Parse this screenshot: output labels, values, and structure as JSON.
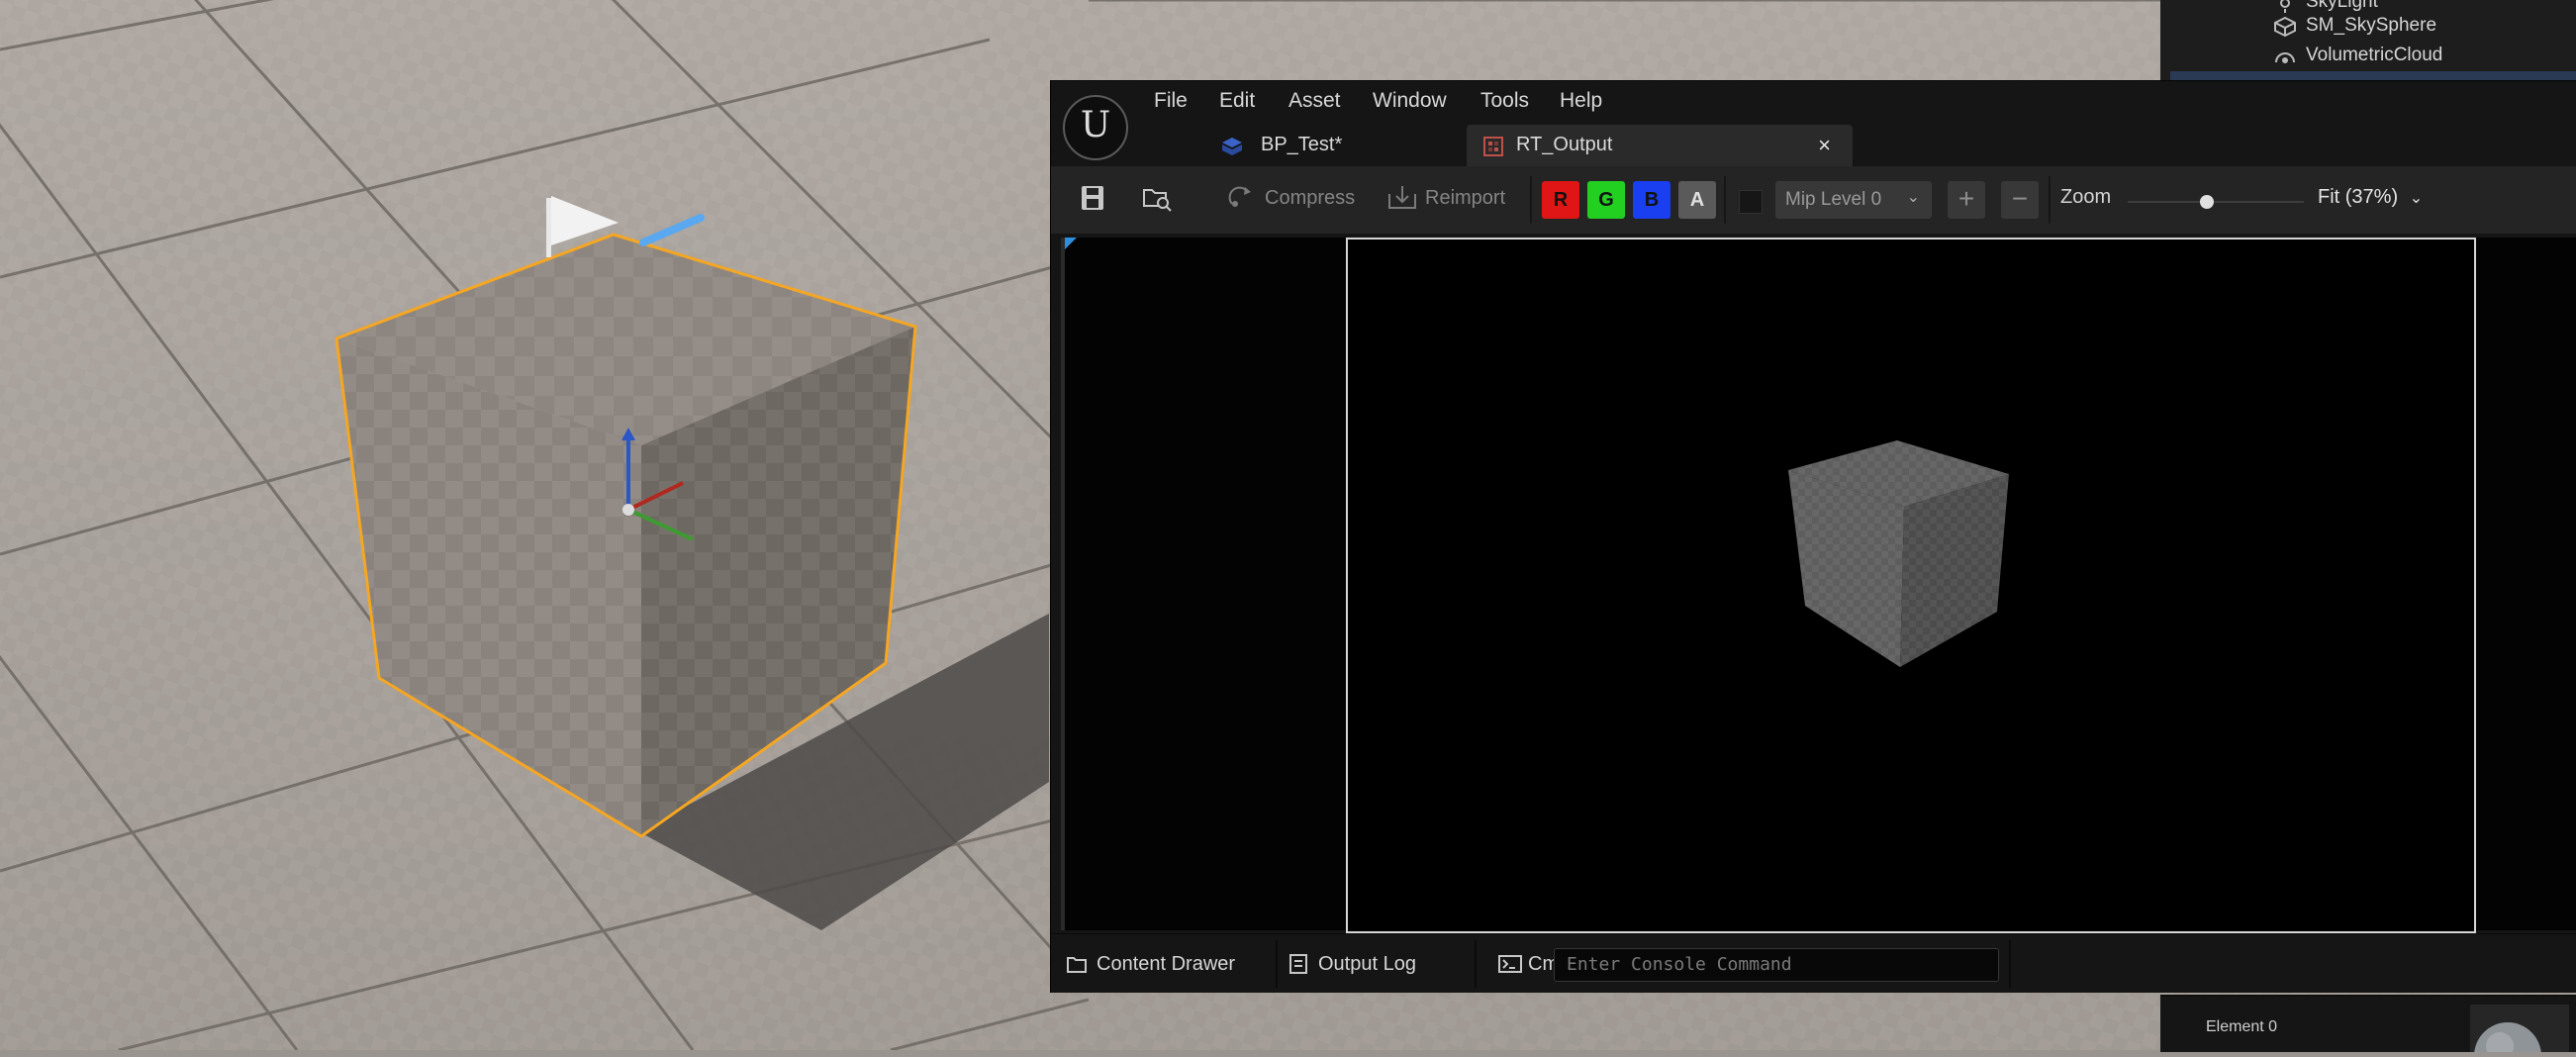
{
  "outliner": {
    "items": [
      {
        "label": "SkyLight",
        "icon": "sky-light-icon"
      },
      {
        "label": "SM_SkySphere",
        "icon": "static-mesh-icon"
      },
      {
        "label": "VolumetricCloud",
        "icon": "volumetric-cloud-icon"
      }
    ]
  },
  "editor": {
    "menu": [
      "File",
      "Edit",
      "Asset",
      "Window",
      "Tools",
      "Help"
    ],
    "logo_glyph": "U",
    "tabs": [
      {
        "label": "BP_Test*",
        "icon": "blueprint-icon",
        "active": false
      },
      {
        "label": "RT_Output",
        "icon": "render-target-icon",
        "active": true
      }
    ],
    "tab_close_glyph": "×",
    "toolbar": {
      "compress_label": "Compress",
      "reimport_label": "Reimport",
      "channels": [
        {
          "label": "R",
          "color": "#e01515"
        },
        {
          "label": "G",
          "color": "#22d022"
        },
        {
          "label": "B",
          "color": "#1a3ff0"
        },
        {
          "label": "A",
          "color": "#5a5a5a"
        }
      ],
      "mip_level": "Mip Level 0",
      "chevron_glyph": "⌄",
      "plus_glyph": "+",
      "minus_glyph": "−",
      "zoom_label": "Zoom",
      "zoom_level": 0.45,
      "fit_label": "Fit (37%)"
    },
    "statusbar": {
      "content_drawer": "Content Drawer",
      "output_log": "Output Log",
      "cmd": "Cmd",
      "console_placeholder": "Enter Console Command"
    }
  },
  "details": {
    "element_label": "Element 0"
  },
  "colors": {
    "selection_outline": "#f5a623",
    "accent_blue": "#2e8fe0"
  }
}
